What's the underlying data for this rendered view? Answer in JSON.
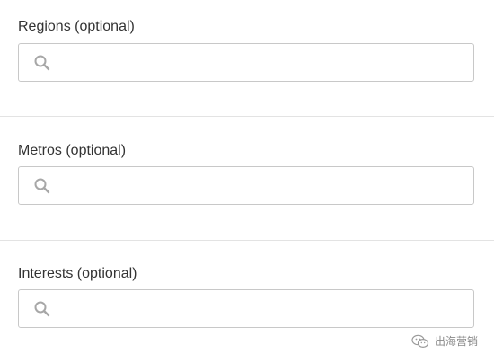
{
  "fields": [
    {
      "label": "Regions (optional)",
      "value": "",
      "placeholder": ""
    },
    {
      "label": "Metros (optional)",
      "value": "",
      "placeholder": ""
    },
    {
      "label": "Interests (optional)",
      "value": "",
      "placeholder": ""
    }
  ],
  "icons": {
    "search": "search-icon",
    "watermark": "wechat-icon"
  },
  "colors": {
    "label_text": "#333333",
    "field_border": "#c8c8c8",
    "icon": "#a7a7a7",
    "divider": "#e3e3e3",
    "background": "#ffffff"
  },
  "watermark": {
    "text": "出海营销"
  }
}
